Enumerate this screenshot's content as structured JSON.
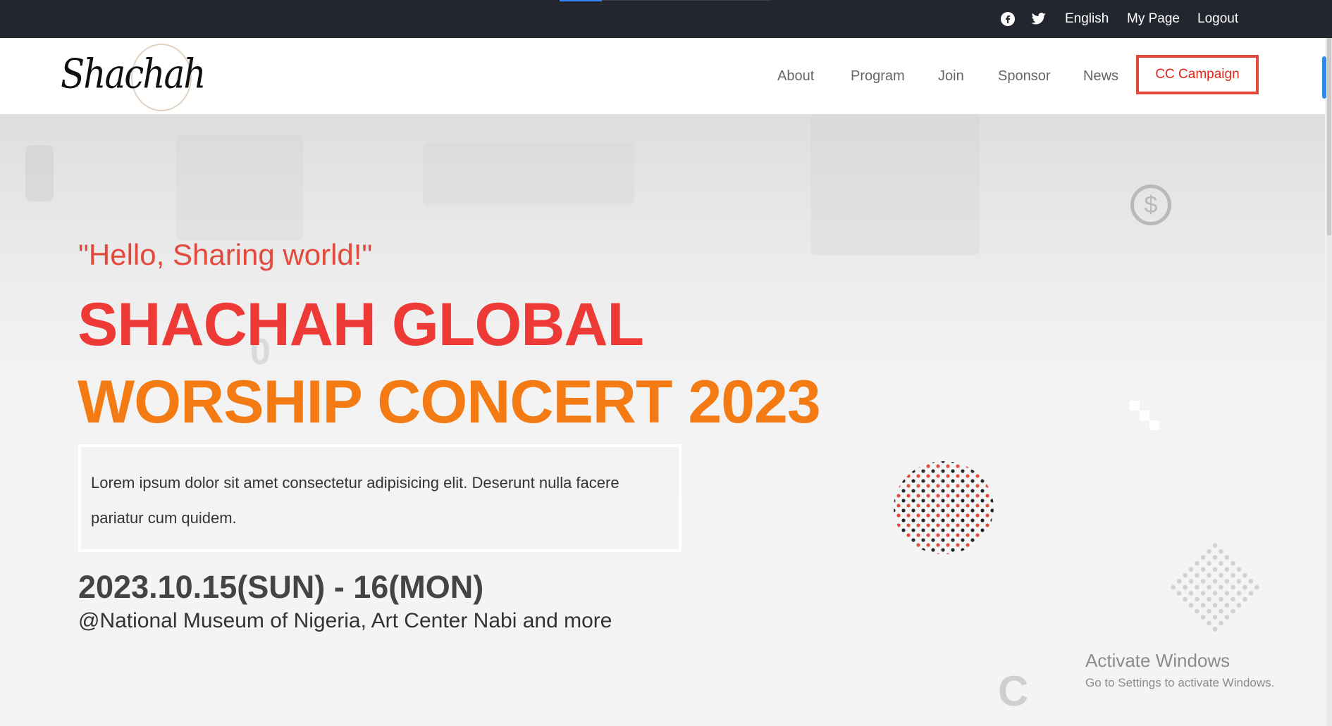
{
  "topbar": {
    "icons": [
      "facebook-icon",
      "twitter-icon"
    ],
    "language": "English",
    "my_page": "My Page",
    "logout": "Logout"
  },
  "header": {
    "logo_text": "Shachah",
    "nav": [
      "About",
      "Program",
      "Join",
      "Sponsor",
      "News"
    ],
    "cta": "CC Campaign"
  },
  "hero": {
    "tagline": "\"Hello, Sharing world!\"",
    "title_line1": "SHACHAH GLOBAL",
    "title_line2": "WORSHIP CONCERT 2023",
    "description": "Lorem ipsum dolor sit amet consectetur adipisicing elit. Deserunt nulla facere pariatur cum quidem.",
    "date": "2023.10.15(SUN) - 16(MON)",
    "venue": "@National Museum of Nigeria, Art Center Nabi and more"
  },
  "watermark": {
    "title": "Activate Windows",
    "subtitle": "Go to Settings to activate Windows."
  },
  "colors": {
    "topbar_bg": "#23262e",
    "accent_red": "#e14a3c",
    "title_orange": "#f47a14"
  }
}
